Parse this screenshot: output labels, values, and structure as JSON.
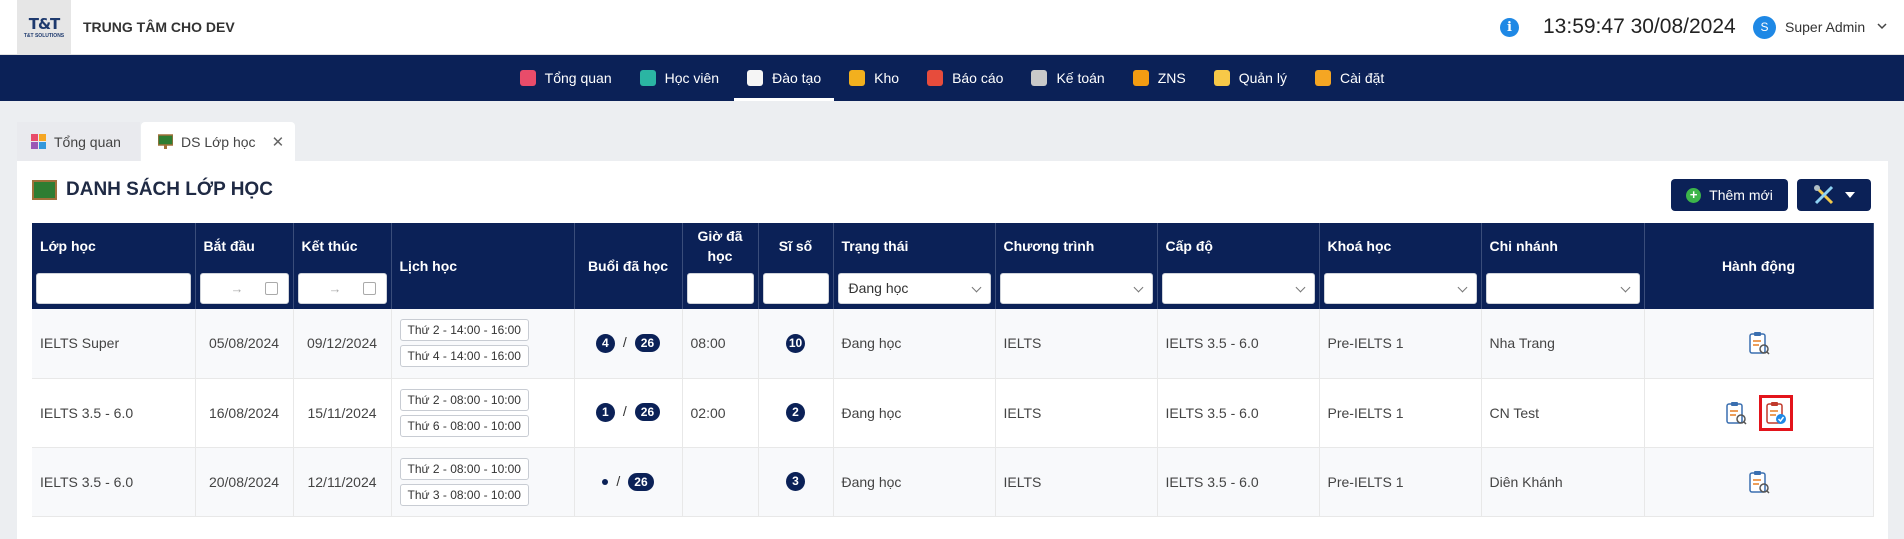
{
  "header": {
    "org_name": "TRUNG TÂM CHO DEV",
    "logo_text": "T&T",
    "logo_sub": "T&T SOLUTIONS",
    "clock": "13:59:47 30/08/2024",
    "user_initial": "S",
    "user_name": "Super Admin"
  },
  "nav": [
    {
      "label": "Tổng quan",
      "icon": "dashboard-icon",
      "color": "#e84c6a"
    },
    {
      "label": "Học viên",
      "icon": "student-icon",
      "color": "#2bb5a3"
    },
    {
      "label": "Đào tạo",
      "icon": "training-icon",
      "color": "#f5f5f5"
    },
    {
      "label": "Kho",
      "icon": "warehouse-icon",
      "color": "#f2b01e"
    },
    {
      "label": "Báo cáo",
      "icon": "report-icon",
      "color": "#e74c3c"
    },
    {
      "label": "Kế toán",
      "icon": "accounting-icon",
      "color": "#c9c9c9"
    },
    {
      "label": "ZNS",
      "icon": "zns-icon",
      "color": "#f39c12"
    },
    {
      "label": "Quản lý",
      "icon": "management-icon",
      "color": "#f7c948"
    },
    {
      "label": "Cài đặt",
      "icon": "settings-icon",
      "color": "#f5a623"
    }
  ],
  "nav_active_index": 2,
  "tabs": [
    {
      "label": "Tổng quan"
    },
    {
      "label": "DS Lớp học",
      "close": "✕"
    }
  ],
  "page": {
    "title": "DANH SÁCH LỚP HỌC",
    "add_button": "Thêm mới"
  },
  "table": {
    "columns": [
      "Lớp học",
      "Bắt đầu",
      "Kết thúc",
      "Lịch học",
      "Buổi đã học",
      "Giờ đã học",
      "Sĩ số",
      "Trạng thái",
      "Chương trình",
      "Cấp độ",
      "Khoá học",
      "Chi nhánh",
      "Hành động"
    ],
    "filters": {
      "date_arrow": "→",
      "status_selected": "Đang học"
    },
    "rows": [
      {
        "class": "IELTS Super",
        "start": "05/08/2024",
        "end": "09/12/2024",
        "schedule": [
          "Thứ 2 - 14:00 - 16:00",
          "Thứ 4 - 14:00 - 16:00"
        ],
        "sessions_done": "4",
        "sessions_total": "26",
        "hours": "08:00",
        "size": "10",
        "status": "Đang học",
        "program": "IELTS",
        "level": "IELTS 3.5 - 6.0",
        "course": "Pre-IELTS 1",
        "branch": "Nha Trang"
      },
      {
        "class": "IELTS 3.5 - 6.0",
        "start": "16/08/2024",
        "end": "15/11/2024",
        "schedule": [
          "Thứ 2 - 08:00 - 10:00",
          "Thứ 6 - 08:00 - 10:00"
        ],
        "sessions_done": "1",
        "sessions_total": "26",
        "hours": "02:00",
        "size": "2",
        "status": "Đang học",
        "program": "IELTS",
        "level": "IELTS 3.5 - 6.0",
        "course": "Pre-IELTS 1",
        "branch": "CN Test"
      },
      {
        "class": "IELTS 3.5 - 6.0",
        "start": "20/08/2024",
        "end": "12/11/2024",
        "schedule": [
          "Thứ 2 - 08:00 - 10:00",
          "Thứ 3 - 08:00 - 10:00"
        ],
        "sessions_done": "",
        "sessions_total": "26",
        "hours": "",
        "size": "3",
        "status": "Đang học",
        "program": "IELTS",
        "level": "IELTS 3.5 - 6.0",
        "course": "Pre-IELTS 1",
        "branch": "Diên Khánh"
      }
    ]
  },
  "colors": {
    "navy": "#0b2157",
    "accent_blue": "#1e88e5",
    "highlight_red": "#e3141b",
    "add_green": "#3cb54a"
  }
}
